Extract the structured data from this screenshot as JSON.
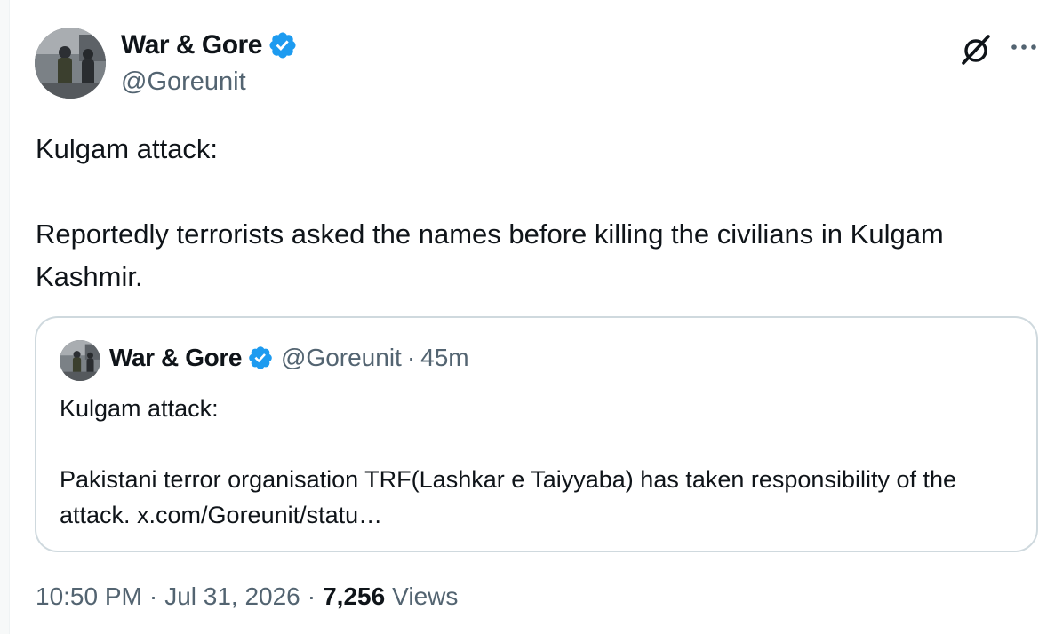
{
  "tweet": {
    "author_name": "War & Gore",
    "handle": "@Goreunit",
    "text_line1": "Kulgam attack:",
    "text_line2": "Reportedly terrorists asked the names before killing the civilians in Kulgam Kashmir.",
    "time": "10:50 PM",
    "date": "Jul 31, 2026",
    "views_count": "7,256",
    "views_label": "Views",
    "separator": "·"
  },
  "quote": {
    "author_name": "War & Gore",
    "handle": "@Goreunit",
    "separator": "·",
    "time_ago": "45m",
    "text_line1": "Kulgam attack:",
    "text_line2": "Pakistani terror organisation TRF(Lashkar e Taiyyaba) has taken responsibility of the attack. x.com/Goreunit/statu…"
  },
  "icons": {
    "verified": "verified-badge-icon",
    "grok": "grok-icon",
    "more": "more-options-icon"
  },
  "colors": {
    "verified_blue": "#1d9bf0",
    "secondary_text": "#536471",
    "primary_text": "#0f1419",
    "border": "#cfd9de"
  }
}
